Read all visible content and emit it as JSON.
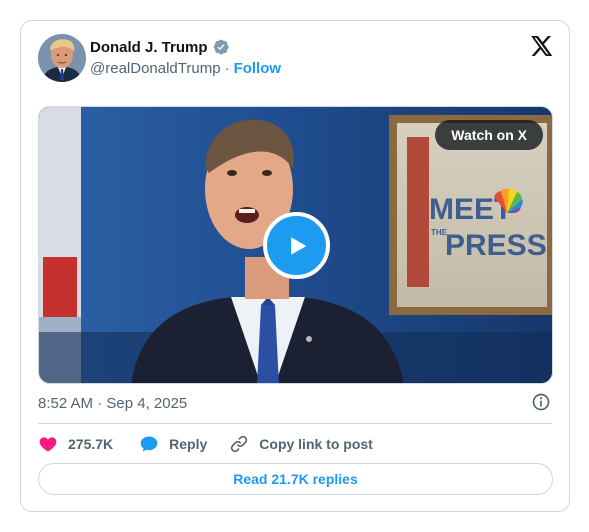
{
  "author": {
    "name": "Donald J. Trump",
    "handle": "@realDonaldTrump",
    "separator": "·",
    "follow_label": "Follow"
  },
  "media": {
    "watch_label": "Watch on X",
    "backdrop_text_line1": "MEET",
    "backdrop_text_line2": "PRESS",
    "backdrop_text_small": "THE"
  },
  "timestamp": "8:52 AM · Sep 4, 2025",
  "actions": {
    "likes_count": "275.7K",
    "reply_label": "Reply",
    "copy_link_label": "Copy link to post"
  },
  "read_replies_label": "Read 21.7K replies",
  "colors": {
    "accent": "#1d9bf0",
    "like": "#f91880",
    "text_secondary": "#536471",
    "text_primary": "#0f1419",
    "border": "#cfd9de"
  },
  "icons": {
    "verified": "verified-badge-icon",
    "brand": "x-logo-icon",
    "play": "play-icon",
    "info": "info-icon",
    "like": "heart-icon",
    "reply": "speech-bubble-icon",
    "copy": "link-icon"
  }
}
